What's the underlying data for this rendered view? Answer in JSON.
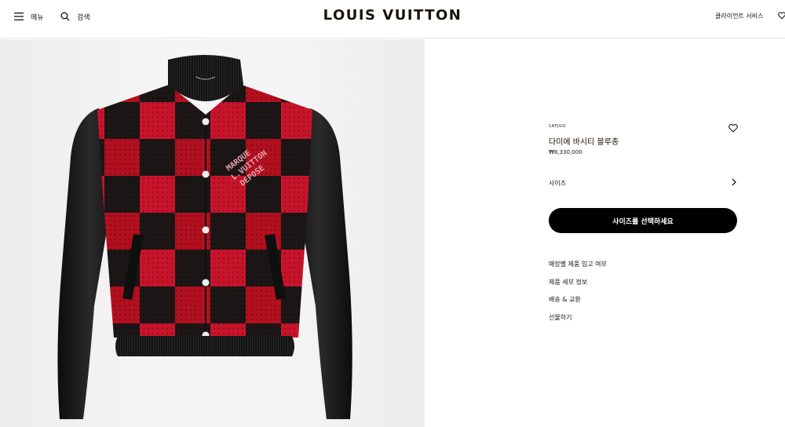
{
  "header": {
    "menu_label": "메뉴",
    "search_label": "검색",
    "brand": "LOUIS VUITTON",
    "client_service": "클라이언트 서비스"
  },
  "product": {
    "eyebrow": "1AFJGO",
    "name": "다미에 바시티 블루종",
    "price": "₩8,330,000",
    "size_label": "사이즈",
    "cta_label": "사이즈를 선택하세요",
    "jacket_embroidery": [
      "MARQUE",
      "L.VUITTON",
      "DEPOSE"
    ]
  },
  "links": [
    "매장별 제품 입고 여부",
    "제품 세부 정보",
    "배송 & 교환",
    "선물하기"
  ],
  "colors": {
    "accent": "#000000",
    "check_red": "#c8142a",
    "check_black": "#161212",
    "leather": "#121212"
  }
}
